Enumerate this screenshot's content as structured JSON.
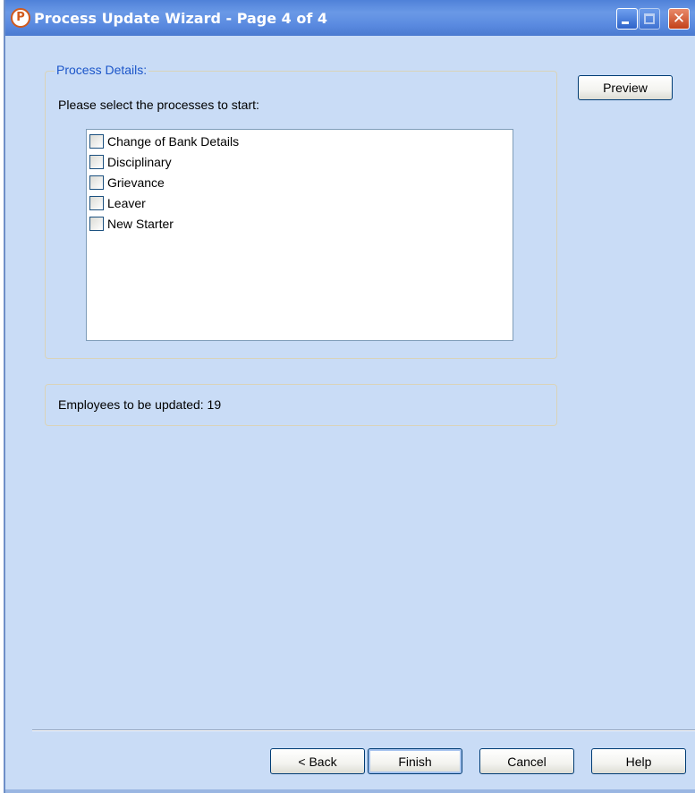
{
  "window": {
    "title": "Process Update Wizard - Page 4 of 4",
    "icon": "app-logo-icon",
    "controls": [
      "minimize-icon",
      "maximize-icon",
      "close-icon"
    ]
  },
  "process_details": {
    "legend": "Process Details:",
    "prompt": "Please select the processes to start:",
    "items": [
      {
        "label": "Change of Bank Details",
        "checked": false
      },
      {
        "label": "Disciplinary",
        "checked": false
      },
      {
        "label": "Grievance",
        "checked": false
      },
      {
        "label": "Leaver",
        "checked": false
      },
      {
        "label": "New Starter",
        "checked": false
      }
    ]
  },
  "employees": {
    "text": "Employees to be updated: 19"
  },
  "buttons": {
    "preview": "Preview",
    "back": "< Back",
    "finish": "Finish",
    "cancel": "Cancel",
    "help": "Help"
  },
  "colors": {
    "dialog_background": "#c9dcf6",
    "title_bar": "#5a8ae0",
    "legend_text": "#1c56c9",
    "close_button": "#c2411a"
  }
}
